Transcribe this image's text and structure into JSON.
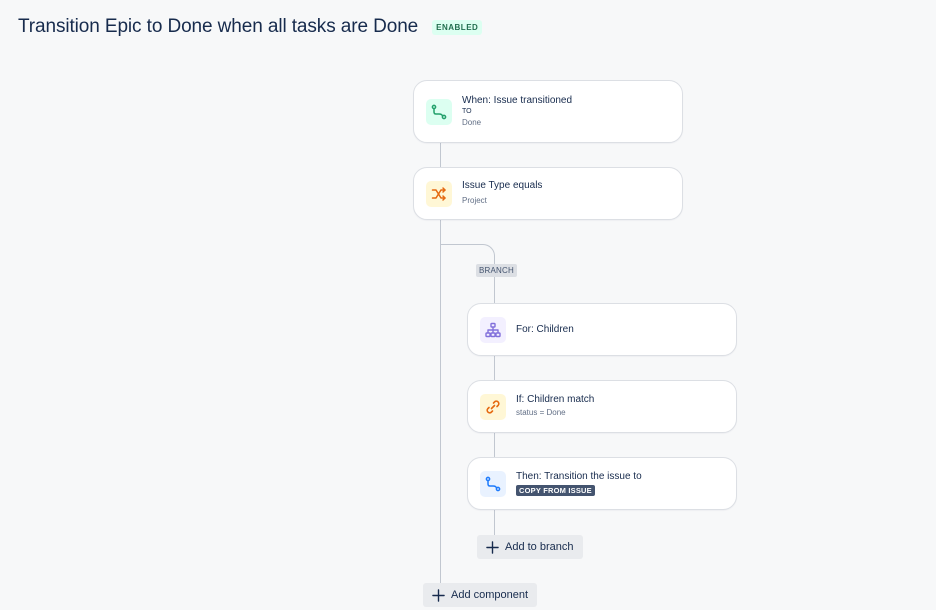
{
  "header": {
    "title": "Transition Epic to Done when all tasks are Done",
    "status_badge": "ENABLED"
  },
  "colors": {
    "trigger_icon_bg": "#dcfff1",
    "trigger_icon": "#22a06b",
    "condition_icon_bg": "#fff7d6",
    "condition_icon": "#e56910",
    "branch_icon_bg": "#f3f0ff",
    "branch_icon": "#8270db",
    "action_icon_bg": "#e9f2ff",
    "action_icon": "#1d7afc"
  },
  "components": {
    "trigger": {
      "icon": "transition-icon",
      "title": "When: Issue transitioned",
      "to_label": "TO",
      "detail": "Done"
    },
    "condition": {
      "icon": "shuffle-icon",
      "title": "Issue Type equals",
      "detail": "Project"
    },
    "branch": {
      "label": "BRANCH",
      "for": {
        "icon": "hierarchy-icon",
        "title": "For: Children"
      },
      "if": {
        "icon": "link-icon",
        "title": "If: Children match",
        "detail": "status = Done"
      },
      "then": {
        "icon": "transition-icon",
        "title": "Then: Transition the issue to",
        "lozenge": "COPY FROM ISSUE"
      },
      "add_label": "Add to branch"
    },
    "add_component_label": "Add component"
  }
}
